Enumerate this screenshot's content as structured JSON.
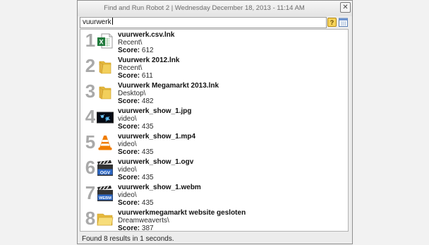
{
  "window": {
    "title": "Find and Run Robot 2 | Wednesday December 18, 2013  -  11:14 AM",
    "close_label": "✕"
  },
  "search": {
    "value": "vuurwerk"
  },
  "results": [
    {
      "rank": "1",
      "name": "vuurwerk.csv.lnk",
      "path": "Recent\\",
      "score_label": "Score:",
      "score": "612",
      "icon": "excel-icon"
    },
    {
      "rank": "2",
      "name": "Vuurwerk 2012.lnk",
      "path": "Recent\\",
      "score_label": "Score:",
      "score": "611",
      "icon": "folder-icon"
    },
    {
      "rank": "3",
      "name": "Vuurwerk Megamarkt 2013.lnk",
      "path": "Desktop\\",
      "score_label": "Score:",
      "score": "482",
      "icon": "folder-icon"
    },
    {
      "rank": "4",
      "name": "vuurwerk_show_1.jpg",
      "path": "video\\",
      "score_label": "Score:",
      "score": "435",
      "icon": "image-icon"
    },
    {
      "rank": "5",
      "name": "vuurwerk_show_1.mp4",
      "path": "video\\",
      "score_label": "Score:",
      "score": "435",
      "icon": "vlc-icon"
    },
    {
      "rank": "6",
      "name": "vuurwerk_show_1.ogv",
      "path": "video\\",
      "score_label": "Score:",
      "score": "435",
      "icon": "ogv-clapper-icon",
      "badge": "OGV"
    },
    {
      "rank": "7",
      "name": "vuurwerk_show_1.webm",
      "path": "video\\",
      "score_label": "Score:",
      "score": "435",
      "icon": "webm-clapper-icon",
      "badge": "WEBM"
    },
    {
      "rank": "8",
      "name": "vuurwerkmegamarkt website gesloten",
      "path": "Dreamweaverts\\",
      "score_label": "Score:",
      "score": "387",
      "icon": "folder-open-icon"
    }
  ],
  "status": {
    "text": "Found 8 results in 1 seconds."
  },
  "colors": {
    "folder": "#f2cf5b",
    "excel": "#1f7a3b",
    "vlc": "#f07d00"
  }
}
